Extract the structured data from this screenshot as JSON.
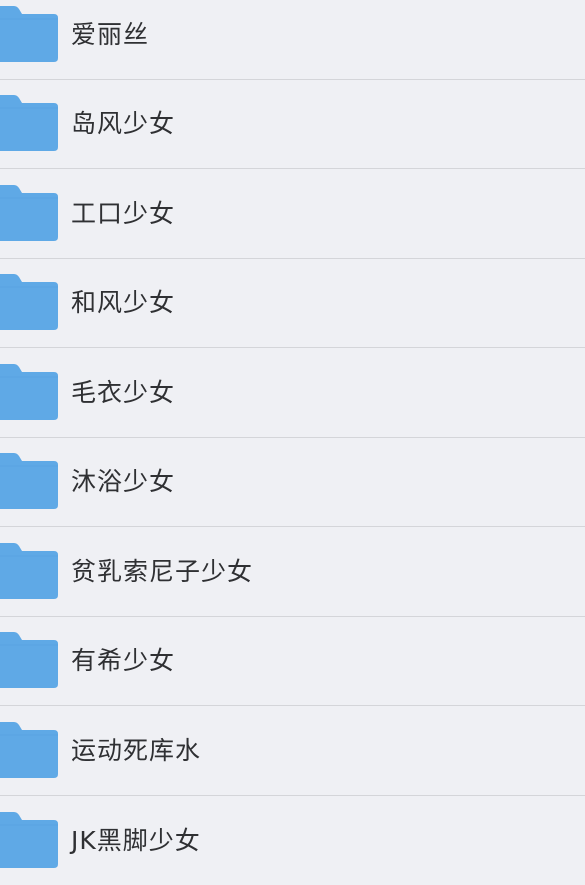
{
  "folder_icon": "folder-icon",
  "colors": {
    "background": "#eff0f4",
    "folder": "#5fa9e6",
    "divider": "#d4d5d9",
    "text": "#2f3033"
  },
  "folders": [
    {
      "name": "爱丽丝"
    },
    {
      "name": "岛风少女"
    },
    {
      "name": "工口少女"
    },
    {
      "name": "和风少女"
    },
    {
      "name": "毛衣少女"
    },
    {
      "name": "沐浴少女"
    },
    {
      "name": "贫乳索尼子少女"
    },
    {
      "name": "有希少女"
    },
    {
      "name": "运动死库水"
    },
    {
      "name": "JK黑脚少女"
    }
  ]
}
